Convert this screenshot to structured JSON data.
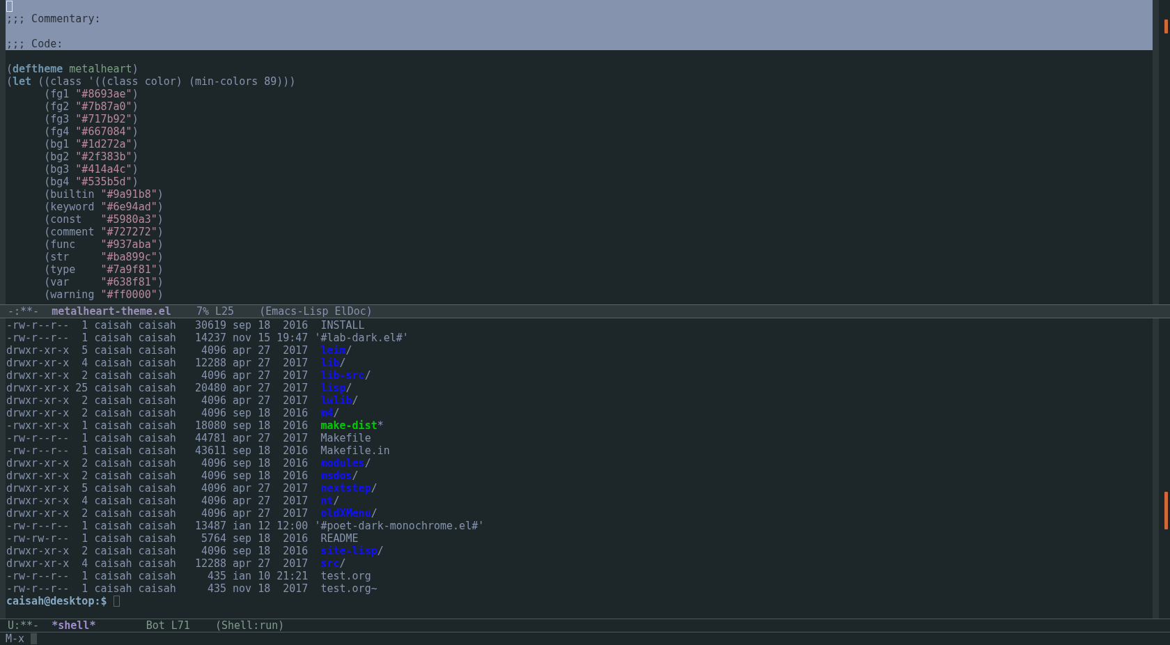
{
  "code_window": {
    "selection": [
      {
        "kind": "cursor"
      },
      {
        "kind": "code",
        "segments": [
          {
            "text": ";;; Commentary:",
            "kind": "comment"
          }
        ]
      },
      {
        "kind": "blank"
      },
      {
        "kind": "code",
        "segments": [
          {
            "text": ";;; Code:",
            "kind": "comment"
          }
        ]
      }
    ],
    "lines": [
      {
        "kind": "blank"
      },
      {
        "kind": "code",
        "segments": [
          {
            "text": "(",
            "kind": "plain"
          },
          {
            "text": "deftheme",
            "kind": "keyword"
          },
          {
            "text": " metalheart",
            "kind": "name"
          },
          {
            "text": ")",
            "kind": "plain"
          }
        ]
      },
      {
        "kind": "code",
        "segments": [
          {
            "text": "(",
            "kind": "plain"
          },
          {
            "text": "let",
            "kind": "keyword"
          },
          {
            "text": " ((class '((class color) (min-colors 89)))",
            "kind": "plain"
          }
        ]
      },
      {
        "kind": "code",
        "segments": [
          {
            "text": "      (fg1 ",
            "kind": "plain"
          },
          {
            "text": "\"#8693ae\"",
            "kind": "string"
          },
          {
            "text": ")",
            "kind": "plain"
          }
        ]
      },
      {
        "kind": "code",
        "segments": [
          {
            "text": "      (fg2 ",
            "kind": "plain"
          },
          {
            "text": "\"#7b87a0\"",
            "kind": "string"
          },
          {
            "text": ")",
            "kind": "plain"
          }
        ]
      },
      {
        "kind": "code",
        "segments": [
          {
            "text": "      (fg3 ",
            "kind": "plain"
          },
          {
            "text": "\"#717b92\"",
            "kind": "string"
          },
          {
            "text": ")",
            "kind": "plain"
          }
        ]
      },
      {
        "kind": "code",
        "segments": [
          {
            "text": "      (fg4 ",
            "kind": "plain"
          },
          {
            "text": "\"#667084\"",
            "kind": "string"
          },
          {
            "text": ")",
            "kind": "plain"
          }
        ]
      },
      {
        "kind": "code",
        "segments": [
          {
            "text": "      (bg1 ",
            "kind": "plain"
          },
          {
            "text": "\"#1d272a\"",
            "kind": "string"
          },
          {
            "text": ")",
            "kind": "plain"
          }
        ]
      },
      {
        "kind": "code",
        "segments": [
          {
            "text": "      (bg2 ",
            "kind": "plain"
          },
          {
            "text": "\"#2f383b\"",
            "kind": "string"
          },
          {
            "text": ")",
            "kind": "plain"
          }
        ]
      },
      {
        "kind": "code",
        "segments": [
          {
            "text": "      (bg3 ",
            "kind": "plain"
          },
          {
            "text": "\"#414a4c\"",
            "kind": "string"
          },
          {
            "text": ")",
            "kind": "plain"
          }
        ]
      },
      {
        "kind": "code",
        "segments": [
          {
            "text": "      (bg4 ",
            "kind": "plain"
          },
          {
            "text": "\"#535b5d\"",
            "kind": "string"
          },
          {
            "text": ")",
            "kind": "plain"
          }
        ]
      },
      {
        "kind": "code",
        "segments": [
          {
            "text": "      (builtin ",
            "kind": "plain"
          },
          {
            "text": "\"#9a91b8\"",
            "kind": "string"
          },
          {
            "text": ")",
            "kind": "plain"
          }
        ]
      },
      {
        "kind": "code",
        "segments": [
          {
            "text": "      (keyword ",
            "kind": "plain"
          },
          {
            "text": "\"#6e94ad\"",
            "kind": "string"
          },
          {
            "text": ")",
            "kind": "plain"
          }
        ]
      },
      {
        "kind": "code",
        "segments": [
          {
            "text": "      (const   ",
            "kind": "plain"
          },
          {
            "text": "\"#5980a3\"",
            "kind": "string"
          },
          {
            "text": ")",
            "kind": "plain"
          }
        ]
      },
      {
        "kind": "code",
        "segments": [
          {
            "text": "      (comment ",
            "kind": "plain"
          },
          {
            "text": "\"#727272\"",
            "kind": "string"
          },
          {
            "text": ")",
            "kind": "plain"
          }
        ]
      },
      {
        "kind": "code",
        "segments": [
          {
            "text": "      (func    ",
            "kind": "plain"
          },
          {
            "text": "\"#937aba\"",
            "kind": "string"
          },
          {
            "text": ")",
            "kind": "plain"
          }
        ]
      },
      {
        "kind": "code",
        "segments": [
          {
            "text": "      (str     ",
            "kind": "plain"
          },
          {
            "text": "\"#ba899c\"",
            "kind": "string"
          },
          {
            "text": ")",
            "kind": "plain"
          }
        ]
      },
      {
        "kind": "code",
        "segments": [
          {
            "text": "      (type    ",
            "kind": "plain"
          },
          {
            "text": "\"#7a9f81\"",
            "kind": "string"
          },
          {
            "text": ")",
            "kind": "plain"
          }
        ]
      },
      {
        "kind": "code",
        "segments": [
          {
            "text": "      (var     ",
            "kind": "plain"
          },
          {
            "text": "\"#638f81\"",
            "kind": "string"
          },
          {
            "text": ")",
            "kind": "plain"
          }
        ]
      },
      {
        "kind": "code",
        "segments": [
          {
            "text": "      (warning ",
            "kind": "plain"
          },
          {
            "text": "\"#ff0000\"",
            "kind": "string"
          },
          {
            "text": ")",
            "kind": "plain"
          }
        ]
      }
    ],
    "mode_line": {
      "status": "-:**-",
      "buffer": "metalheart-theme.el",
      "position": "7% L25",
      "modes": "(Emacs-Lisp ElDoc)",
      "active": true
    }
  },
  "shell_window": {
    "listing": [
      {
        "permissions": "-rw-r--r--",
        "links": "1",
        "owner": "caisah",
        "group": "caisah",
        "size": "30619",
        "month": "sep",
        "day": "18",
        "time": "2016",
        "name": "INSTALL",
        "kind": "file"
      },
      {
        "permissions": "-rw-r--r--",
        "links": "1",
        "owner": "caisah",
        "group": "caisah",
        "size": "14237",
        "month": "nov",
        "day": "15",
        "time": "19:47",
        "name": "'#lab-dark.el#'",
        "kind": "quoted"
      },
      {
        "permissions": "drwxr-xr-x",
        "links": "5",
        "owner": "caisah",
        "group": "caisah",
        "size": "4096",
        "month": "apr",
        "day": "27",
        "time": "2017",
        "name": "leim",
        "kind": "dir",
        "indicator": "/"
      },
      {
        "permissions": "drwxr-xr-x",
        "links": "4",
        "owner": "caisah",
        "group": "caisah",
        "size": "12288",
        "month": "apr",
        "day": "27",
        "time": "2017",
        "name": "lib",
        "kind": "dir",
        "indicator": "/"
      },
      {
        "permissions": "drwxr-xr-x",
        "links": "2",
        "owner": "caisah",
        "group": "caisah",
        "size": "4096",
        "month": "apr",
        "day": "27",
        "time": "2017",
        "name": "lib-src",
        "kind": "dir",
        "indicator": "/"
      },
      {
        "permissions": "drwxr-xr-x",
        "links": "25",
        "owner": "caisah",
        "group": "caisah",
        "size": "20480",
        "month": "apr",
        "day": "27",
        "time": "2017",
        "name": "lisp",
        "kind": "dir",
        "indicator": "/"
      },
      {
        "permissions": "drwxr-xr-x",
        "links": "2",
        "owner": "caisah",
        "group": "caisah",
        "size": "4096",
        "month": "apr",
        "day": "27",
        "time": "2017",
        "name": "lwlib",
        "kind": "dir",
        "indicator": "/"
      },
      {
        "permissions": "drwxr-xr-x",
        "links": "2",
        "owner": "caisah",
        "group": "caisah",
        "size": "4096",
        "month": "sep",
        "day": "18",
        "time": "2016",
        "name": "m4",
        "kind": "dir",
        "indicator": "/"
      },
      {
        "permissions": "-rwxr-xr-x",
        "links": "1",
        "owner": "caisah",
        "group": "caisah",
        "size": "18080",
        "month": "sep",
        "day": "18",
        "time": "2016",
        "name": "make-dist",
        "kind": "exec",
        "indicator": "*"
      },
      {
        "permissions": "-rw-r--r--",
        "links": "1",
        "owner": "caisah",
        "group": "caisah",
        "size": "44781",
        "month": "apr",
        "day": "27",
        "time": "2017",
        "name": "Makefile",
        "kind": "file"
      },
      {
        "permissions": "-rw-r--r--",
        "links": "1",
        "owner": "caisah",
        "group": "caisah",
        "size": "43611",
        "month": "sep",
        "day": "18",
        "time": "2016",
        "name": "Makefile.in",
        "kind": "file"
      },
      {
        "permissions": "drwxr-xr-x",
        "links": "2",
        "owner": "caisah",
        "group": "caisah",
        "size": "4096",
        "month": "sep",
        "day": "18",
        "time": "2016",
        "name": "modules",
        "kind": "dir",
        "indicator": "/"
      },
      {
        "permissions": "drwxr-xr-x",
        "links": "2",
        "owner": "caisah",
        "group": "caisah",
        "size": "4096",
        "month": "sep",
        "day": "18",
        "time": "2016",
        "name": "msdos",
        "kind": "dir",
        "indicator": "/"
      },
      {
        "permissions": "drwxr-xr-x",
        "links": "5",
        "owner": "caisah",
        "group": "caisah",
        "size": "4096",
        "month": "apr",
        "day": "27",
        "time": "2017",
        "name": "nextstep",
        "kind": "dir",
        "indicator": "/"
      },
      {
        "permissions": "drwxr-xr-x",
        "links": "4",
        "owner": "caisah",
        "group": "caisah",
        "size": "4096",
        "month": "apr",
        "day": "27",
        "time": "2017",
        "name": "nt",
        "kind": "dir",
        "indicator": "/"
      },
      {
        "permissions": "drwxr-xr-x",
        "links": "2",
        "owner": "caisah",
        "group": "caisah",
        "size": "4096",
        "month": "apr",
        "day": "27",
        "time": "2017",
        "name": "oldXMenu",
        "kind": "dir",
        "indicator": "/"
      },
      {
        "permissions": "-rw-r--r--",
        "links": "1",
        "owner": "caisah",
        "group": "caisah",
        "size": "13487",
        "month": "ian",
        "day": "12",
        "time": "12:00",
        "name": "'#poet-dark-monochrome.el#'",
        "kind": "quoted"
      },
      {
        "permissions": "-rw-rw-r--",
        "links": "1",
        "owner": "caisah",
        "group": "caisah",
        "size": "5764",
        "month": "sep",
        "day": "18",
        "time": "2016",
        "name": "README",
        "kind": "file"
      },
      {
        "permissions": "drwxr-xr-x",
        "links": "2",
        "owner": "caisah",
        "group": "caisah",
        "size": "4096",
        "month": "sep",
        "day": "18",
        "time": "2016",
        "name": "site-lisp",
        "kind": "dir",
        "indicator": "/"
      },
      {
        "permissions": "drwxr-xr-x",
        "links": "4",
        "owner": "caisah",
        "group": "caisah",
        "size": "12288",
        "month": "apr",
        "day": "27",
        "time": "2017",
        "name": "src",
        "kind": "dir",
        "indicator": "/"
      },
      {
        "permissions": "-rw-r--r--",
        "links": "1",
        "owner": "caisah",
        "group": "caisah",
        "size": "435",
        "month": "ian",
        "day": "10",
        "time": "21:21",
        "name": "test.org",
        "kind": "file"
      },
      {
        "permissions": "-rw-r--r--",
        "links": "1",
        "owner": "caisah",
        "group": "caisah",
        "size": "435",
        "month": "nov",
        "day": "18",
        "time": "2017",
        "name": "test.org~",
        "kind": "file"
      }
    ],
    "prompt": {
      "text": "caisah@desktop:$",
      "cursor": true
    },
    "mode_line": {
      "status": "U:**-",
      "buffer": "*shell*",
      "position": "Bot L71",
      "modes": "(Shell:run)",
      "active": false
    }
  },
  "minibuffer": {
    "prompt": "M-x",
    "cursor": true
  }
}
